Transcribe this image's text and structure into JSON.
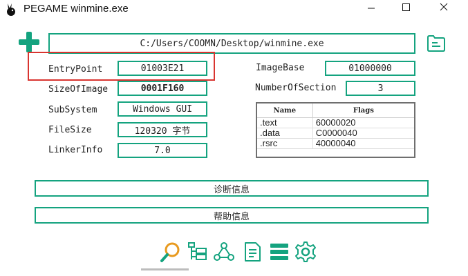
{
  "window": {
    "title": "PEGAME  winmine.exe",
    "minimize_icon": "minimize-icon",
    "maximize_icon": "maximize-icon",
    "close_icon": "close-icon"
  },
  "file": {
    "path": "C:/Users/COOMN/Desktop/winmine.exe"
  },
  "fields": {
    "entry_point": {
      "label": "EntryPoint",
      "value": "01003E21"
    },
    "size_of_image": {
      "label": "SizeOfImage",
      "value": "0001F160"
    },
    "subsystem": {
      "label": "SubSystem",
      "value": "Windows GUI"
    },
    "file_size": {
      "label": "FileSize",
      "value": "120320 字节"
    },
    "linker_info": {
      "label": "LinkerInfo",
      "value": "7.0"
    },
    "image_base": {
      "label": "ImageBase",
      "value": "01000000"
    },
    "number_of_section": {
      "label": "NumberOfSection",
      "value": "3"
    }
  },
  "sections": {
    "headers": [
      "Name",
      "Flags"
    ],
    "rows": [
      [
        ".text",
        "60000020"
      ],
      [
        ".data",
        "C0000040"
      ],
      [
        ".rsrc",
        "40000040"
      ]
    ]
  },
  "buttons": {
    "diagnose": "诊断信息",
    "help": "帮助信息"
  },
  "toolbar_icons": [
    "search-icon",
    "tree-icon",
    "network-icon",
    "document-icon",
    "list-icon",
    "settings-icon"
  ],
  "colors": {
    "accent": "#14a37f",
    "highlight": "#d9342f"
  }
}
